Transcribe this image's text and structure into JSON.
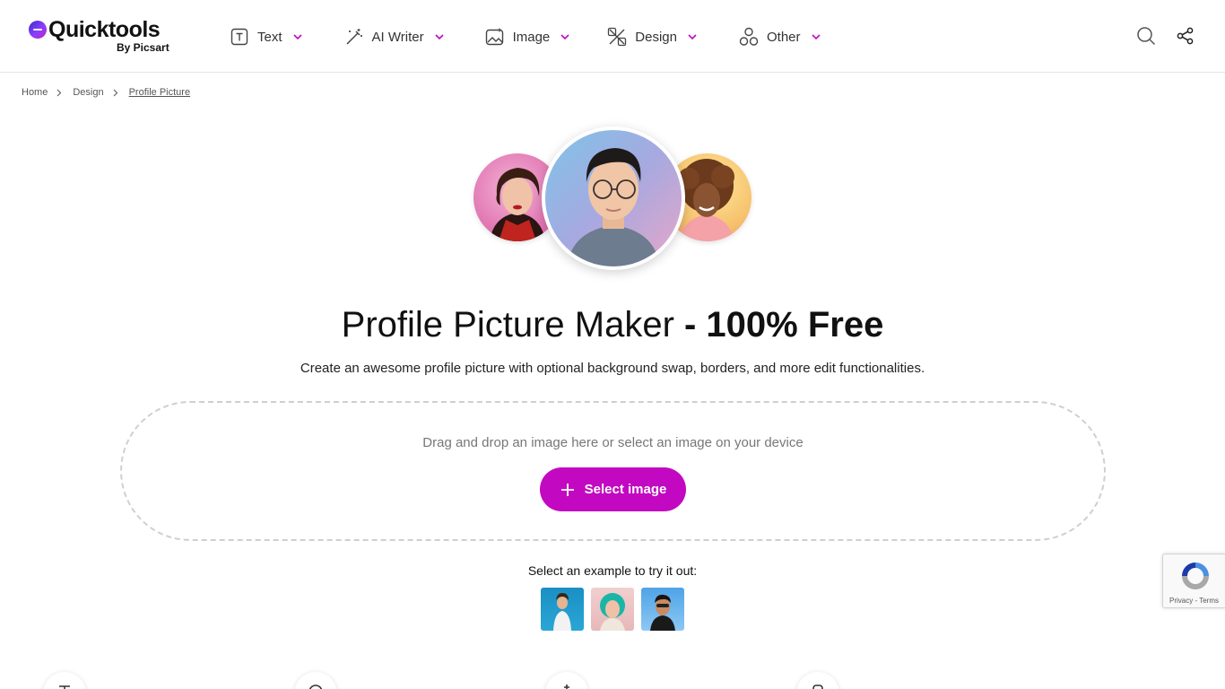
{
  "header": {
    "logo": {
      "name": "Quicktools",
      "sub": "By Picsart"
    },
    "nav": [
      {
        "label": "Text",
        "icon": "text-box-icon"
      },
      {
        "label": "AI Writer",
        "icon": "magic-wand-icon"
      },
      {
        "label": "Image",
        "icon": "image-icon"
      },
      {
        "label": "Design",
        "icon": "design-tools-icon"
      },
      {
        "label": "Other",
        "icon": "shapes-icon"
      }
    ],
    "actions": [
      "search-icon",
      "share-icon"
    ],
    "accent": "#c209c1"
  },
  "breadcrumb": [
    {
      "label": "Home"
    },
    {
      "label": "Design"
    },
    {
      "label": "Profile Picture"
    }
  ],
  "main": {
    "title_light": "Profile Picture Maker ",
    "title_bold": "- 100% Free",
    "subtitle": "Create an awesome profile picture with optional background swap, borders, and more edit functionalities.",
    "dropzone": {
      "hint": "Drag and drop an image here or select an image on your device",
      "button": "Select image"
    },
    "examples_label": "Select an example to try it out:"
  },
  "recaptcha": {
    "text": "Privacy - Terms"
  }
}
